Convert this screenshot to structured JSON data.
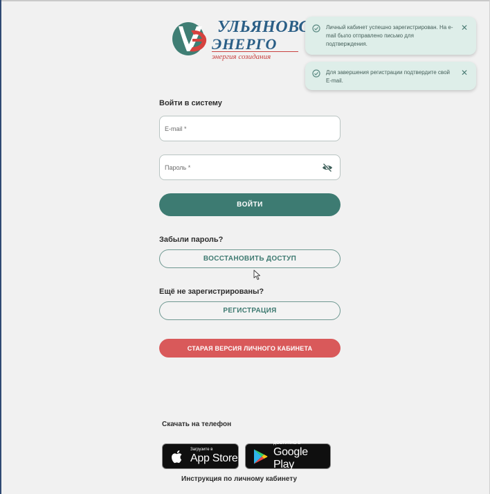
{
  "logo": {
    "line1": "УЛЬЯНОВСК",
    "line2": "ЭНЕРГО",
    "slogan": "энергия созидания"
  },
  "toasts": [
    {
      "message": "Личный кабинет успешно зарегистрирован. На e-mail было отправлено письмо для подтверждения.",
      "close": "✕"
    },
    {
      "message": "Для завершения регистрации подтвердите свой E-mail.",
      "close": "✕"
    }
  ],
  "login": {
    "title": "Войти в систему",
    "email_placeholder": "E-mail *",
    "password_placeholder": "Пароль *",
    "submit_label": "ВОЙТИ"
  },
  "forgot": {
    "label": "Забыли пароль?",
    "button_label": "ВОССТАНОВИТЬ ДОСТУП"
  },
  "register": {
    "label": "Ещё не зарегистрированы?",
    "button_label": "РЕГИСТРАЦИЯ"
  },
  "old_version_label": "СТАРАЯ ВЕРСИЯ ЛИЧНОГО КАБИНЕТА",
  "download": {
    "title": "Скачать на телефон",
    "app_store_small": "Загрузите в",
    "app_store_big": "App Store",
    "google_play_small": "ДОСТУПНО В",
    "google_play_big": "Google Play"
  },
  "manual_link": "Инструкция по личному кабинету",
  "colors": {
    "primary": "#3d7b72",
    "danger": "#d9595a",
    "toast_bg": "#deeee9",
    "brand_blue": "#2a5e86",
    "brand_red": "#c8403f"
  },
  "icons": {
    "toast_status": "check-circle-icon",
    "toast_close": "close-icon",
    "password_toggle": "eye-off-icon",
    "apple": "apple-icon",
    "google_play": "google-play-icon"
  }
}
